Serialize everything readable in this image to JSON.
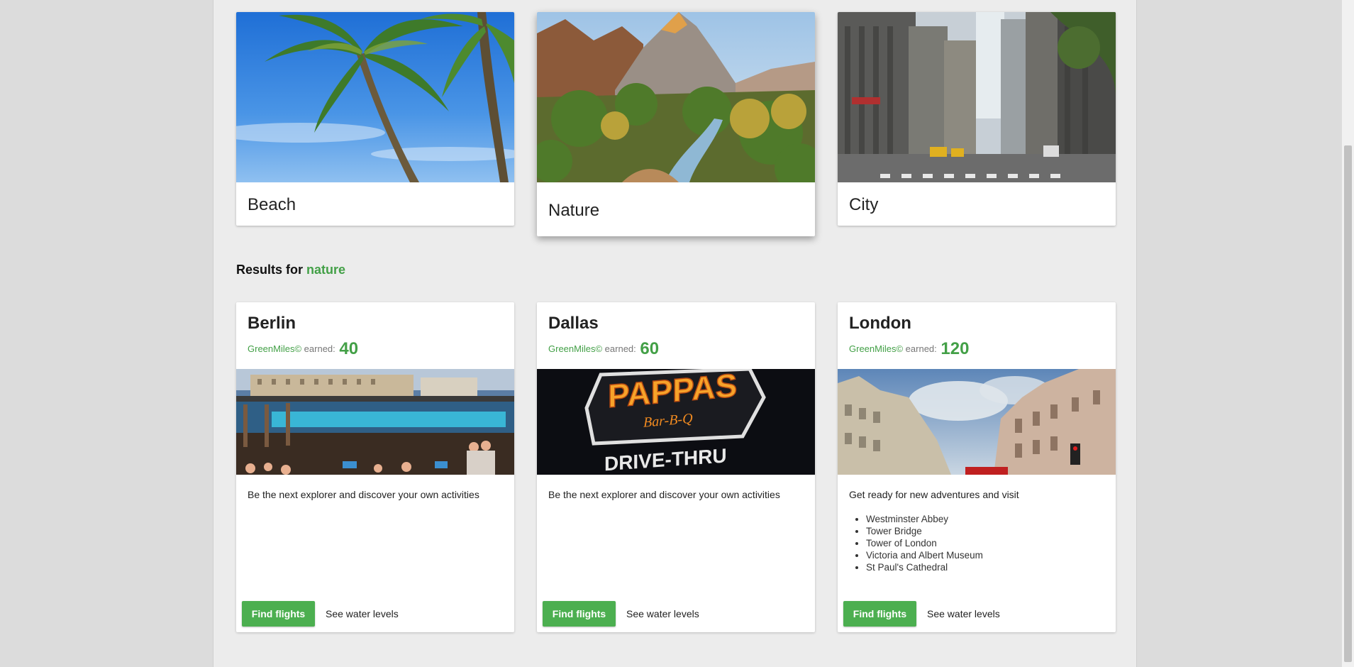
{
  "categories": [
    {
      "label": "Beach"
    },
    {
      "label": "Nature"
    },
    {
      "label": "City"
    }
  ],
  "results": {
    "prefix": "Results for",
    "keyword": "nature"
  },
  "miles_label": "GreenMiles©",
  "earned_label": "earned:",
  "cards": [
    {
      "city": "Berlin",
      "miles": "40",
      "description": "Be the next explorer and discover your own activities",
      "places": []
    },
    {
      "city": "Dallas",
      "miles": "60",
      "description": "Be the next explorer and discover your own activities",
      "places": [],
      "sign_text": "PAPPAS",
      "sign_sub": "Bar-B-Q",
      "sign_bottom": "DRIVE-THRU"
    },
    {
      "city": "London",
      "miles": "120",
      "description": "Get ready for new adventures and visit",
      "places": [
        "Westminster Abbey",
        "Tower Bridge",
        "Tower of London",
        "Victoria and Albert Museum",
        "St Paul's Cathedral"
      ]
    }
  ],
  "buttons": {
    "flights": "Find flights",
    "water": "See water levels"
  },
  "colors": {
    "accent": "#4caf50",
    "accent_text": "#43a047",
    "page_bg": "#ececec"
  }
}
